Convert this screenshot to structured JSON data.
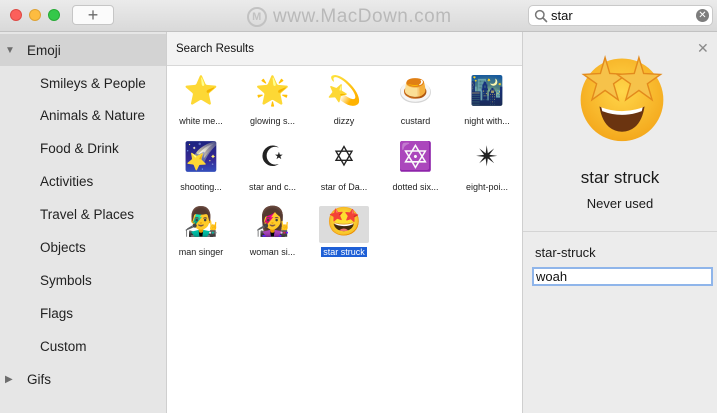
{
  "toolbar": {
    "add_label": "+",
    "watermark": "www.MacDown.com",
    "watermark_logo": "M"
  },
  "search": {
    "value": "star",
    "icon": "magnifier-icon",
    "clear_icon": "clear-icon"
  },
  "sidebar": {
    "emoji_group": {
      "label": "Emoji",
      "expanded": true
    },
    "items": [
      {
        "label": "Smileys & People"
      },
      {
        "label": "Animals & Nature"
      },
      {
        "label": "Food & Drink"
      },
      {
        "label": "Activities"
      },
      {
        "label": "Travel & Places"
      },
      {
        "label": "Objects"
      },
      {
        "label": "Symbols"
      },
      {
        "label": "Flags"
      },
      {
        "label": "Custom"
      }
    ],
    "gifs_group": {
      "label": "Gifs",
      "expanded": false
    }
  },
  "results": {
    "title": "Search Results",
    "items": [
      {
        "emoji": "⭐",
        "label": "white me..."
      },
      {
        "emoji": "🌟",
        "label": "glowing s..."
      },
      {
        "emoji": "💫",
        "label": "dizzy"
      },
      {
        "emoji": "🍮",
        "label": "custard"
      },
      {
        "emoji": "🌃",
        "label": "night with..."
      },
      {
        "emoji": "🌠",
        "label": "shooting..."
      },
      {
        "emoji": "☪",
        "label": "star and c..."
      },
      {
        "emoji": "✡",
        "label": "star of Da..."
      },
      {
        "emoji": "🔯",
        "label": "dotted six..."
      },
      {
        "emoji": "✴",
        "label": "eight-poi..."
      },
      {
        "emoji": "👨‍🎤",
        "label": "man singer"
      },
      {
        "emoji": "👩‍🎤",
        "label": "woman si..."
      },
      {
        "emoji": "🤩",
        "label": "star struck",
        "selected": true
      }
    ]
  },
  "detail": {
    "close_icon": "close-icon",
    "emoji": "🤩",
    "name": "star struck",
    "usage": "Never used",
    "keyword_label": "star-struck",
    "keyword_value": "woah"
  },
  "colors": {
    "selection": "#1e5fd6",
    "sidebar_selected": "#d3d3d3",
    "field_focus": "#8fb5ea"
  }
}
